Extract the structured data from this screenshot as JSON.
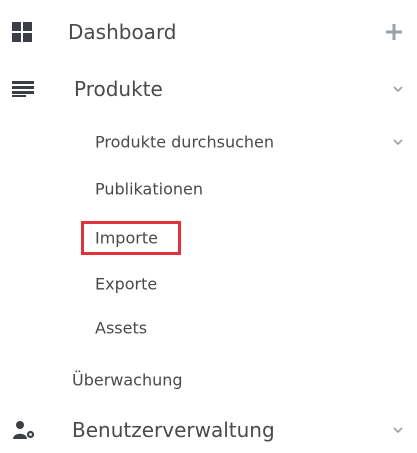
{
  "menu": {
    "dashboard": {
      "label": "Dashboard",
      "icon": "dashboard-grid-icon",
      "action_icon": "plus-icon"
    },
    "produkte": {
      "label": "Produkte",
      "icon": "list-icon",
      "expand_icon": "chevron-down-icon",
      "children": [
        {
          "label": "Produkte durchsuchen",
          "expand_icon": "chevron-down-icon"
        },
        {
          "label": "Publikationen"
        },
        {
          "label": "Importe",
          "highlighted": true
        },
        {
          "label": "Exporte"
        },
        {
          "label": "Assets"
        }
      ]
    },
    "ueberwachung": {
      "label": "Überwachung"
    },
    "benutzerverwaltung": {
      "label": "Benutzerverwaltung",
      "icon": "users-cog-icon",
      "expand_icon": "chevron-down-icon"
    }
  },
  "colors": {
    "text": "#4a4a4a",
    "icon": "#3b3f45",
    "muted_icon": "#9aa0a6",
    "highlight_border": "#e1333b"
  }
}
